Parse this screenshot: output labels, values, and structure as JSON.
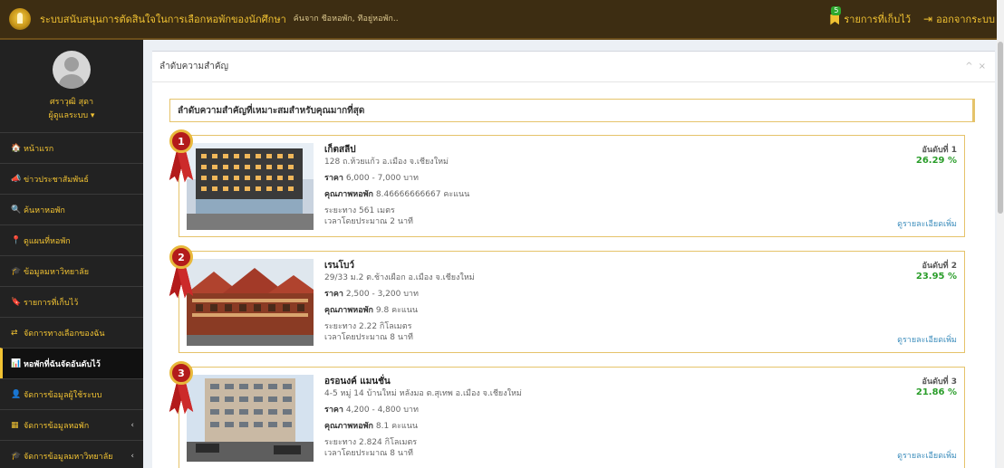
{
  "topbar": {
    "title": "ระบบสนับสนุนการตัดสินใจในการเลือกหอพักของนักศึกษา",
    "search_placeholder": "ค้นจาก ชื่อหอพัก, ที่อยู่หอพัก..",
    "favorites_count": "5",
    "favorites_label": "รายการที่เก็บไว้",
    "logout_label": "ออกจากระบบ"
  },
  "user": {
    "name": "ศราวุฒิ สุดา",
    "role": "ผู้ดูแลระบบ ▾"
  },
  "sidebar": {
    "items": [
      {
        "icon": "🏠",
        "label": "หน้าแรก"
      },
      {
        "icon": "📣",
        "label": "ข่าวประชาสัมพันธ์"
      },
      {
        "icon": "🔍",
        "label": "ค้นหาหอพัก"
      },
      {
        "icon": "📍",
        "label": "ดูแผนที่หอพัก"
      },
      {
        "icon": "🎓",
        "label": "ข้อมูลมหาวิทยาลัย"
      },
      {
        "icon": "🔖",
        "label": "รายการที่เก็บไว้"
      },
      {
        "icon": "⇄",
        "label": "จัดการทางเลือกของฉัน"
      },
      {
        "icon": "📊",
        "label": "หอพักที่ฉันจัดอันดับไว้"
      },
      {
        "icon": "👤",
        "label": "จัดการข้อมูลผู้ใช้ระบบ"
      },
      {
        "icon": "▦",
        "label": "จัดการข้อมูลหอพัก",
        "chevron": "‹"
      },
      {
        "icon": "🎓",
        "label": "จัดการข้อมูลมหาวิทยาลัย",
        "chevron": "‹"
      }
    ]
  },
  "box": {
    "title": "ลำดับความสำคัญ",
    "tools": [
      "^",
      "×"
    ],
    "section_title": "ลำดับความสำคัญที่เหมาะสมสำหรับคุณมากที่สุด"
  },
  "results": [
    {
      "rank": "1",
      "name": "เก็ตสลีป",
      "address": "128 ถ.ห้วยแก้ว อ.เมือง จ.เชียงใหม่",
      "price_label": "ราคา",
      "price": "6,000 - 7,000 บาท",
      "quality_label": "คุณภาพหอพัก",
      "quality": "8.46666666667 คะแนน",
      "distance": "ระยะทาง 561 เมตร",
      "time": "เวลาโดยประมาณ 2 นาที",
      "rank_label": "อันดับที่ 1",
      "percent": "26.29 %",
      "detail_link": "ดูรายละเอียดเพิ่ม",
      "photo": "modern-building-photo"
    },
    {
      "rank": "2",
      "name": "เรนโบว์",
      "address": "29/33 ม.2 ต.ช้างเผือก อ.เมือง จ.เชียงใหม่",
      "price_label": "ราคา",
      "price": "2,500 - 3,200 บาท",
      "quality_label": "คุณภาพหอพัก",
      "quality": "9.8 คะแนน",
      "distance": "ระยะทาง 2.22 กิโลเมตร",
      "time": "เวลาโดยประมาณ 8 นาที",
      "rank_label": "อันดับที่ 2",
      "percent": "23.95 %",
      "detail_link": "ดูรายละเอียดเพิ่ม",
      "photo": "red-roof-building-photo"
    },
    {
      "rank": "3",
      "name": "อรอนงค์ แมนชั่น",
      "address": "4-5 หมู่ 14 บ้านใหม่ หลังมอ ต.สุเทพ อ.เมือง จ.เชียงใหม่",
      "price_label": "ราคา",
      "price": "4,200 - 4,800 บาท",
      "quality_label": "คุณภาพหอพัก",
      "quality": "8.1 คะแนน",
      "distance": "ระยะทาง 2.824 กิโลเมตร",
      "time": "เวลาโดยประมาณ 8 นาที",
      "rank_label": "อันดับที่ 3",
      "percent": "21.86 %",
      "detail_link": "ดูรายละเอียดเพิ่ม",
      "photo": "mansion-building-photo"
    }
  ],
  "colors": {
    "topbar": "#3d2d12",
    "accent": "#f1c232",
    "sidebar": "#222222",
    "percent": "#2a9d2a",
    "link": "#3c8dbc"
  }
}
